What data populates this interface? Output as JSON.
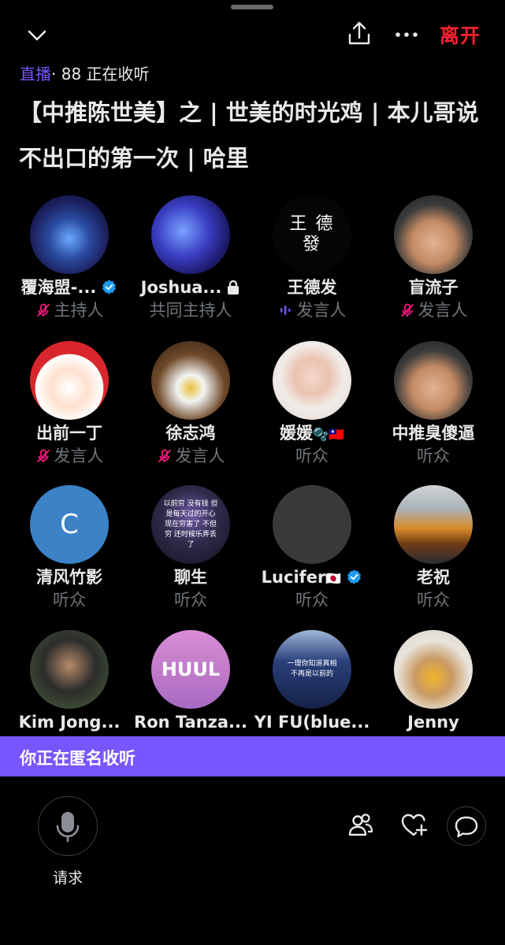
{
  "header": {
    "leave_label": "离开",
    "status_live": "直播",
    "status_count": "· 88 正在收听",
    "title": "【中推陈世美】之 | 世美的时光鸡 | 本儿哥说不出口的第一次 | 哈里"
  },
  "participants": [
    {
      "name": "覆海盟-...",
      "role": "主持人",
      "role_icon": "mic-muted",
      "verified": true
    },
    {
      "name": "Joshua...",
      "role": "共同主持人",
      "role_icon": "",
      "locked": true
    },
    {
      "name": "王德发",
      "role": "发言人",
      "role_icon": "speaking",
      "avatar_text": "王 德 發"
    },
    {
      "name": "盲流子",
      "role": "发言人",
      "role_icon": "mic-muted"
    },
    {
      "name": "出前一丁",
      "role": "发言人",
      "role_icon": "mic-muted"
    },
    {
      "name": "徐志鸿",
      "role": "发言人",
      "role_icon": "mic-muted"
    },
    {
      "name": "媛媛",
      "role": "听众",
      "role_icon": "",
      "emoji": "🫧🇹🇼"
    },
    {
      "name": "中推臭傻逼",
      "role": "听众",
      "role_icon": ""
    },
    {
      "name": "清风竹影",
      "role": "听众",
      "role_icon": "",
      "avatar_text": "C"
    },
    {
      "name": "聊生",
      "role": "听众",
      "role_icon": "",
      "avatar_text": "以前穷 没有钱 但是每天过的开心 现在穷害了 不但穷 还时候乐弄丢了"
    },
    {
      "name": "Lucifer",
      "role": "听众",
      "role_icon": "",
      "emoji": "🇯🇵",
      "verified": true
    },
    {
      "name": "老祝",
      "role": "听众",
      "role_icon": ""
    },
    {
      "name": "Kim Jong...",
      "role": "",
      "role_icon": ""
    },
    {
      "name": "Ron Tanza...",
      "role": "",
      "role_icon": "",
      "avatar_text": "HUUL"
    },
    {
      "name": "YI FU(blue...",
      "role": "",
      "role_icon": "",
      "avatar_text": "一理你知道真相 不再是以前的"
    },
    {
      "name": "Jenny",
      "role": "",
      "role_icon": ""
    }
  ],
  "banner": {
    "text": "你正在匿名收听"
  },
  "footer": {
    "request_label": "请求"
  },
  "colors": {
    "accent": "#7856ff",
    "leave": "#f4212e",
    "muted_mic": "#f91880",
    "verified": "#1d9bf0",
    "secondary_text": "#71767b"
  }
}
